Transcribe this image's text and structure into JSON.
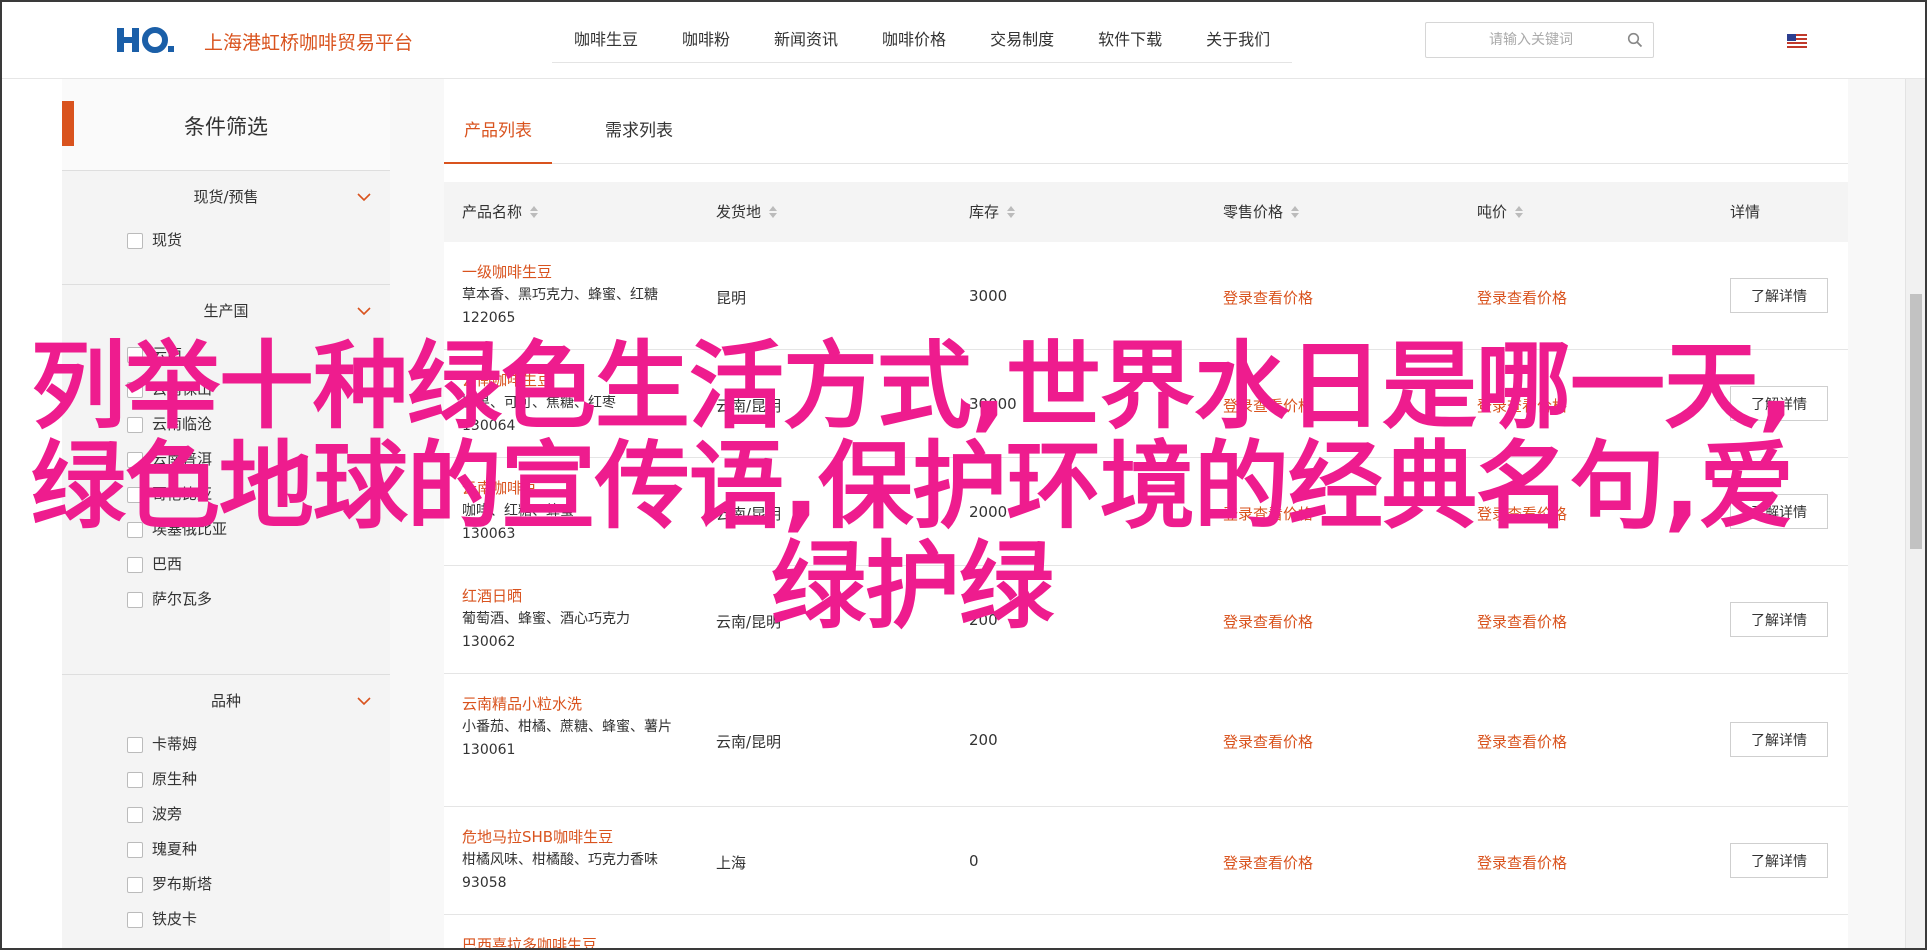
{
  "header": {
    "brand": "上海港虹桥咖啡贸易平台",
    "nav": [
      "咖啡生豆",
      "咖啡粉",
      "新闻资讯",
      "咖啡价格",
      "交易制度",
      "软件下载",
      "关于我们"
    ],
    "search_placeholder": "请输入关键词",
    "icons": {
      "search": "search-icon",
      "flag": "us-flag-icon",
      "logo": "hq-logo"
    }
  },
  "sidebar": {
    "title": "条件筛选",
    "groups": [
      {
        "label": "现货/预售",
        "options": [
          "现货"
        ]
      },
      {
        "label": "生产国",
        "options": [
          "云南",
          "云南保山",
          "云南临沧",
          "云南普洱",
          "哥伦比亚",
          "埃塞俄比亚",
          "巴西",
          "萨尔瓦多"
        ]
      },
      {
        "label": "品种",
        "options": [
          "卡蒂姆",
          "原生种",
          "波旁",
          "瑰夏种",
          "罗布斯塔",
          "铁皮卡"
        ]
      }
    ]
  },
  "tabs": [
    "产品列表",
    "需求列表"
  ],
  "table": {
    "headers": [
      "产品名称",
      "发货地",
      "库存",
      "零售价格",
      "吨价",
      "详情"
    ],
    "price_link": "登录查看价格",
    "detail_label": "了解详情",
    "rows": [
      {
        "name": "一级咖啡生豆",
        "desc": "草本香、黑巧克力、蜂蜜、红糖",
        "code": "122065",
        "origin": "昆明",
        "stock": "3000"
      },
      {
        "name": "云南咖啡生豆",
        "desc": "坚果、可可、焦糖、红枣",
        "code": "130064",
        "origin": "云南/昆明",
        "stock": "30000"
      },
      {
        "name": "云南咖啡豆",
        "desc": "咖啡、红糖、蜂蜜",
        "code": "130063",
        "origin": "云南/昆明",
        "stock": "2000"
      },
      {
        "name": "红酒日晒",
        "desc": "葡萄酒、蜂蜜、酒心巧克力",
        "code": "130062",
        "origin": "云南/昆明",
        "stock": "200"
      },
      {
        "name": "云南精品小粒水洗",
        "desc": "小番茄、柑橘、蔗糖、蜂蜜、薯片",
        "code": "130061",
        "origin": "云南/昆明",
        "stock": "200"
      },
      {
        "name": "危地马拉SHB咖啡生豆",
        "desc": "柑橘风味、柑橘酸、巧克力香味",
        "code": "93058",
        "origin": "上海",
        "stock": "0"
      },
      {
        "name": "巴西喜拉多咖啡生豆",
        "desc": "",
        "code": "",
        "origin": "",
        "stock": ""
      }
    ]
  },
  "overlay": {
    "line1": "列举十种绿色生活方式,世界水日是哪一天,",
    "line2": "绿色地球的宣传语,保护环境的经典名句,爱",
    "line3": "绿护绿"
  }
}
